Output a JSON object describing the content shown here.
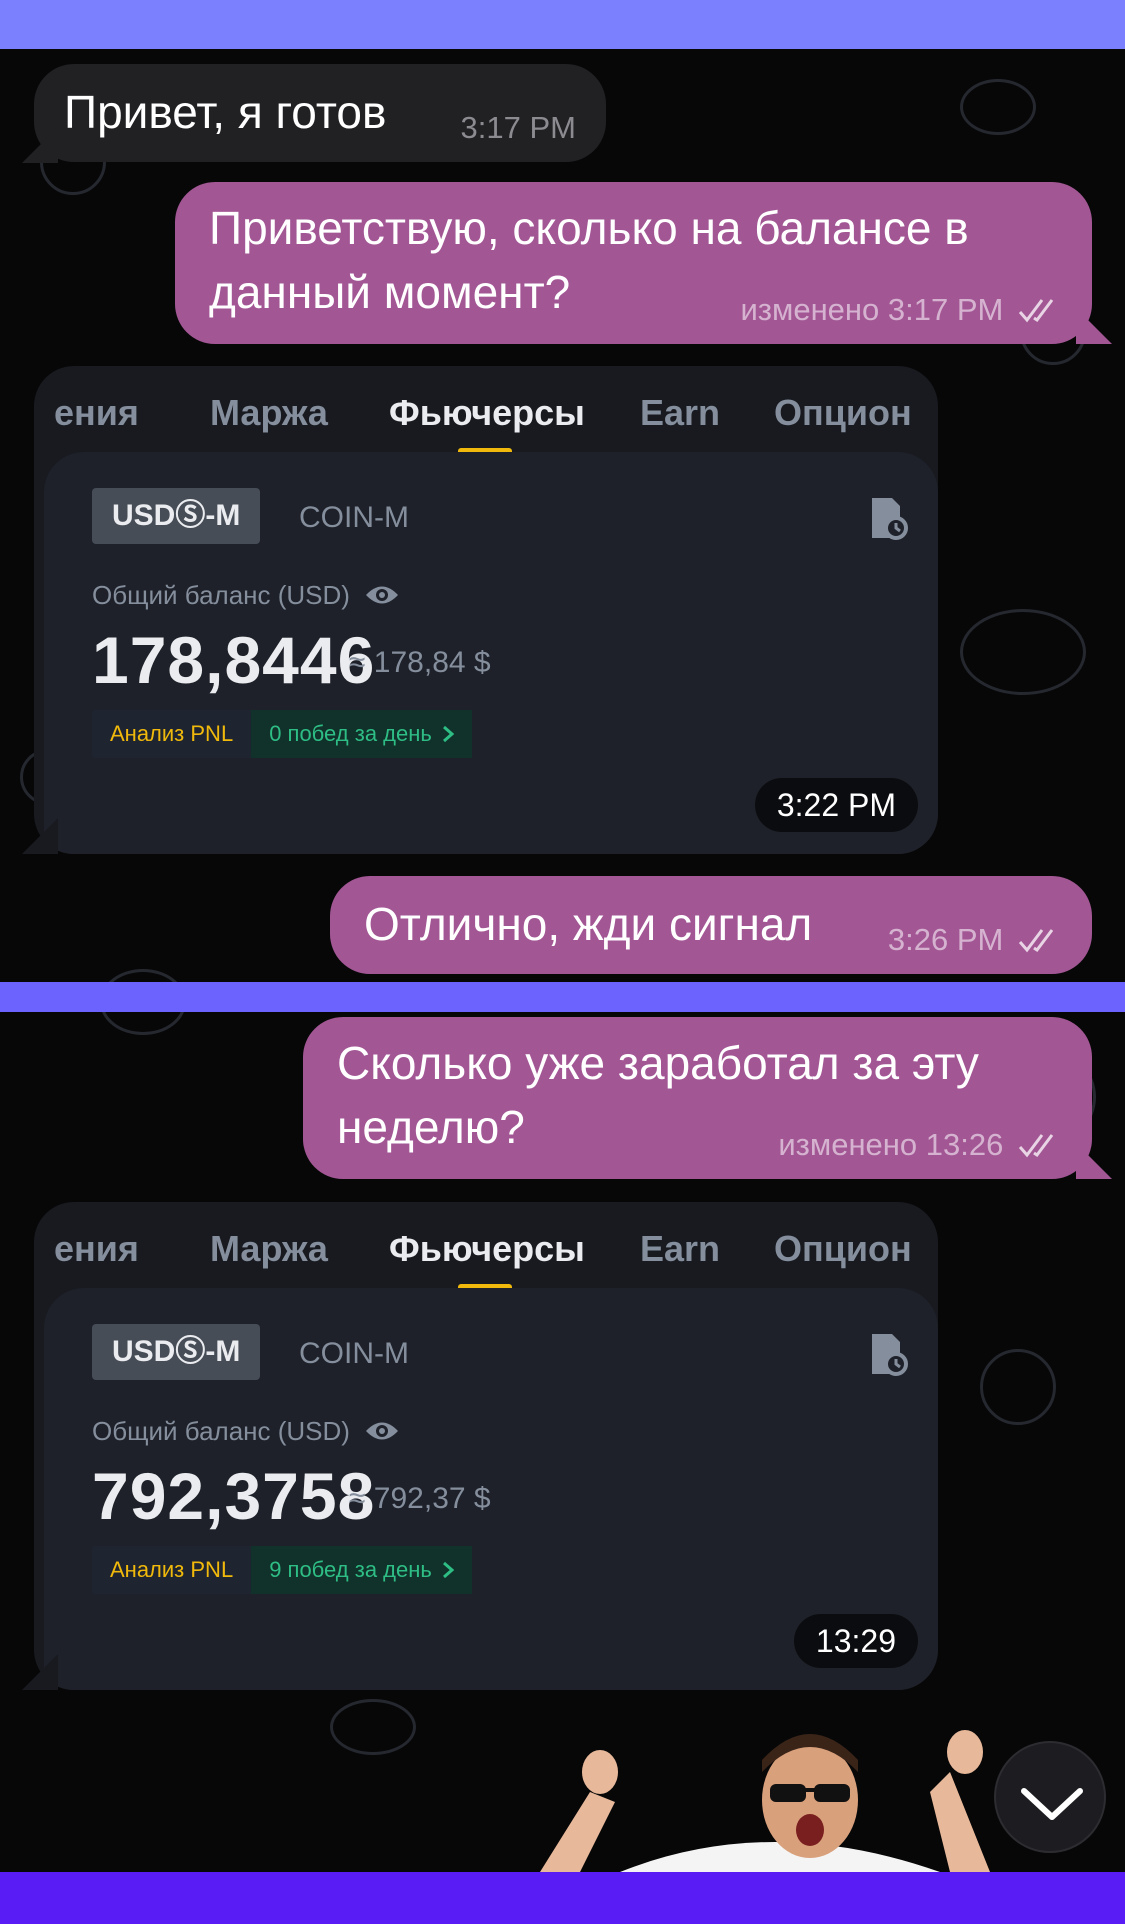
{
  "messages": [
    {
      "side": "in",
      "text": "Привет, я готов",
      "time": "3:17 PM"
    },
    {
      "side": "out",
      "text": "Приветствую, сколько на балансе в данный момент?",
      "edited": "изменено",
      "time": "3:17 PM"
    },
    {
      "side": "out",
      "text": "Отлично, жди сигнал",
      "time": "3:26 PM"
    },
    {
      "side": "out",
      "text": "Сколько уже заработал за эту неделю?",
      "edited": "изменено",
      "time": "13:26"
    }
  ],
  "screenshots": [
    {
      "tabs": [
        "ения",
        "Маржа",
        "Фьючерсы",
        "Earn",
        "Опцион"
      ],
      "active_tab": "Фьючерсы",
      "seg_active": "USDⓈ-M",
      "seg_other": "COIN-M",
      "balance_label": "Общий баланс (USD)",
      "balance": "178,8446",
      "approx": "≈ 178,84 $",
      "pnl_label": "Анализ PNL",
      "wins": "0 побед за день",
      "time": "3:22 PM"
    },
    {
      "tabs": [
        "ения",
        "Маржа",
        "Фьючерсы",
        "Earn",
        "Опцион"
      ],
      "active_tab": "Фьючерсы",
      "seg_active": "USDⓈ-M",
      "seg_other": "COIN-M",
      "balance_label": "Общий баланс (USD)",
      "balance": "792,3758",
      "approx": "≈ 792,37 $",
      "pnl_label": "Анализ PNL",
      "wins": "9 побед за день",
      "time": "13:29"
    }
  ],
  "icons": {
    "read_receipt": "double-check-icon",
    "history": "history-icon",
    "visibility": "eye-icon",
    "pnl_arrow": "chevron-right-icon",
    "scroll_down": "chevron-down-icon"
  },
  "colors": {
    "outgoing_bubble": "#a25694",
    "incoming_bubble": "#212124",
    "active_tab_underline": "#f0b90b",
    "pnl_wins": "#2ebd85"
  }
}
